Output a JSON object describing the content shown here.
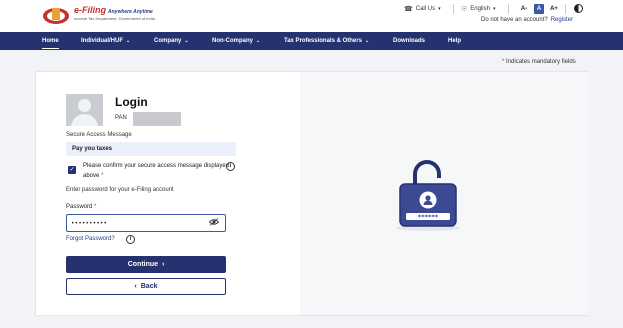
{
  "header": {
    "brand_title": "e-Filing",
    "brand_tag": "Anywhere Anytime",
    "brand_sub": "Income Tax Department, Government of India",
    "call_us": "Call Us",
    "language": "English",
    "font_decrease": "A-",
    "font_default": "A",
    "font_increase": "A+",
    "account_prompt": "Do not have an account?",
    "register": "Register"
  },
  "nav": {
    "items": [
      {
        "label": "Home",
        "dropdown": false,
        "active": true
      },
      {
        "label": "Individual/HUF",
        "dropdown": true
      },
      {
        "label": "Company",
        "dropdown": true
      },
      {
        "label": "Non-Company",
        "dropdown": true
      },
      {
        "label": "Tax Professionals & Others",
        "dropdown": true
      },
      {
        "label": "Downloads",
        "dropdown": false
      },
      {
        "label": "Help",
        "dropdown": false
      }
    ]
  },
  "mandatory_note": "Indicates mandatory fields",
  "login": {
    "title": "Login",
    "pan_label": "PAN",
    "secure_label": "Secure Access Message",
    "secure_message": "Pay you taxes",
    "confirm_text": "Please confirm your secure access message displayed above",
    "enter_password": "Enter password for your e-Filing account",
    "password_label": "Password",
    "password_value": "••••••••••",
    "forgot": "Forgot Password?",
    "continue": "Continue",
    "back": "Back"
  },
  "lock": {
    "mask": "******"
  },
  "colors": {
    "primary": "#25326f",
    "accent": "#3b58a6",
    "brand_red": "#c4322a"
  }
}
